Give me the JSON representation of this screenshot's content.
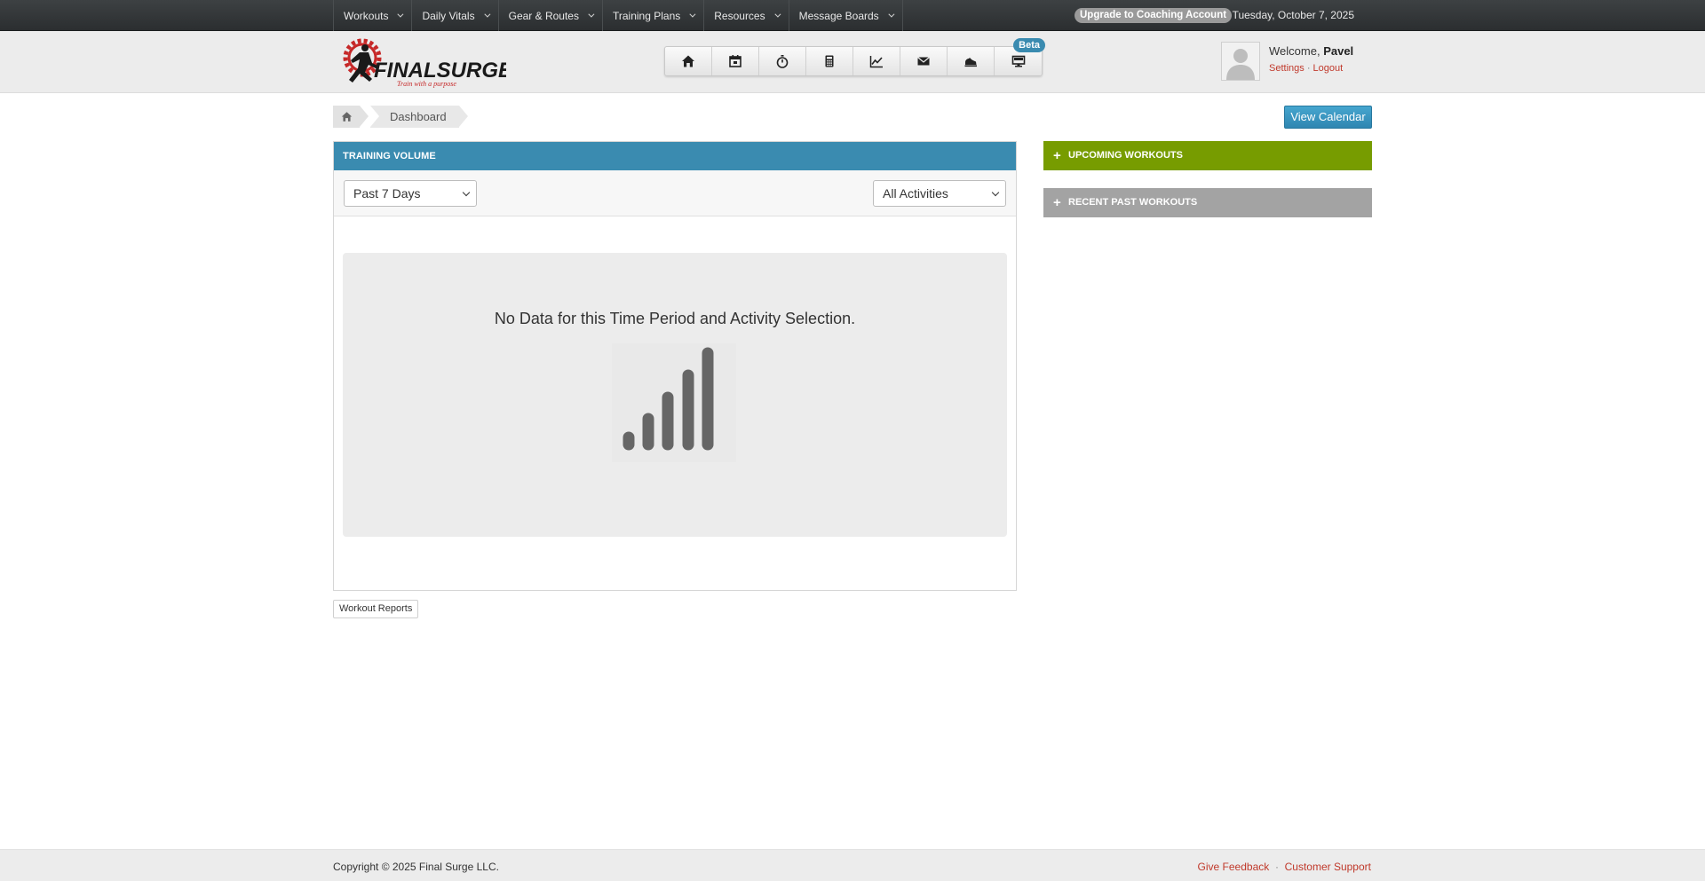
{
  "topnav": {
    "menu": [
      {
        "label": "Workouts"
      },
      {
        "label": "Daily Vitals"
      },
      {
        "label": "Gear & Routes"
      },
      {
        "label": "Training Plans"
      },
      {
        "label": "Resources"
      },
      {
        "label": "Message Boards"
      }
    ],
    "upgrade_label": "Upgrade to Coaching Account",
    "date": "Tuesday, October 7, 2025"
  },
  "header": {
    "logo_text": "FINALSURGE",
    "logo_tagline": "Train with a purpose",
    "icons": [
      "home-icon",
      "calendar-icon",
      "stopwatch-icon",
      "calculator-icon",
      "chart-icon",
      "mail-icon",
      "shoe-icon",
      "monitor-icon"
    ],
    "beta_label": "Beta",
    "welcome_prefix": "Welcome,",
    "user_name": "Pavel",
    "settings_label": "Settings",
    "separator": "·",
    "logout_label": "Logout"
  },
  "breadcrumb": {
    "current": "Dashboard"
  },
  "actions": {
    "view_calendar": "View Calendar",
    "workout_reports": "Workout Reports"
  },
  "training_volume": {
    "title": "TRAINING VOLUME",
    "period_selected": "Past 7 Days",
    "activity_selected": "All Activities",
    "empty_message": "No Data for this Time Period and Activity Selection."
  },
  "side": {
    "upcoming_title": "UPCOMING WORKOUTS",
    "recent_title": "RECENT PAST WORKOUTS"
  },
  "footer": {
    "copyright": "Copyright © 2025 Final Surge LLC.",
    "feedback": "Give Feedback",
    "separator": "·",
    "support": "Customer Support"
  },
  "colors": {
    "panel_blue": "#3a8bb0",
    "upcoming_green": "#779c00",
    "recent_gray": "#a3a3a3",
    "link_red": "#c0392b"
  }
}
